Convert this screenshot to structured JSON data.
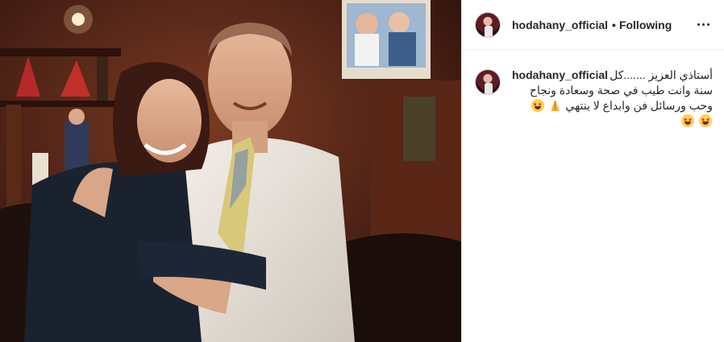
{
  "post": {
    "username": "hodahany_official",
    "separator": "•",
    "follow_state": "Following",
    "more_icon": "more-options-icon"
  },
  "caption": {
    "username": "hodahany_official",
    "line1": "أستاذي العزيز .......كل",
    "line2": "سنة وانت طيب في صحة وسعادة ونجاح",
    "line3": "وحب ورسائل فن وابداع لا ينتهي",
    "emojis_line3": [
      "star-struck-emoji",
      "folded-hands-emoji",
      "star-struck-emoji"
    ],
    "emojis_line4": [
      "star-struck-emoji",
      "star-struck-emoji"
    ]
  },
  "colors": {
    "text": "#262626",
    "border": "#efefef",
    "photo_bg": "#3a1c12"
  }
}
